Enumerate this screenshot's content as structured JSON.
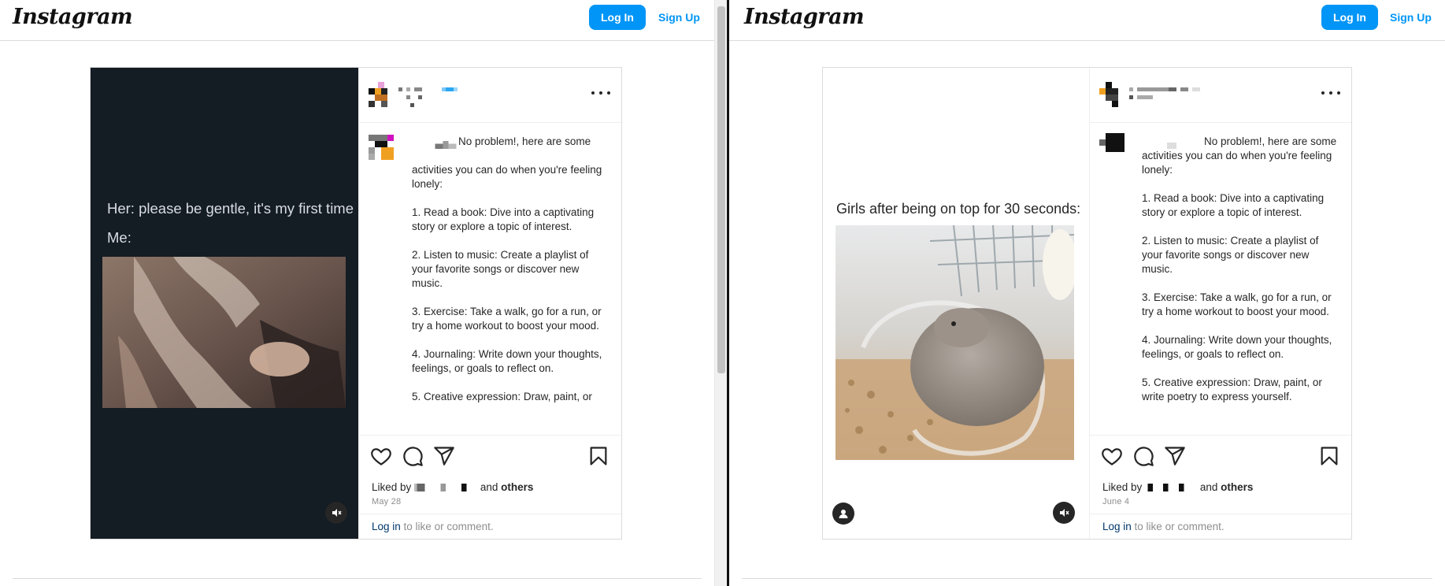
{
  "brand": {
    "logo_text": "Instagram",
    "accent_color": "#0095f6",
    "link_color": "#00376b"
  },
  "nav": {
    "login_label": "Log In",
    "signup_label": "Sign Up"
  },
  "posts": [
    {
      "meme_lines": [
        "Her: please be gentle, it's my first time",
        "Me:"
      ],
      "caption": "No problem!, here are some\n\nactivities you can do when you're feeling lonely:\n\n1. Read a book: Dive into a captivating story or explore a topic of interest.\n\n2. Listen to music: Create a playlist of your favorite songs or discover new music.\n\n3. Exercise: Take a walk, go for a run, or try a home workout to boost your mood.\n\n4. Journaling: Write down your thoughts, feelings, or goals to reflect on.\n\n5. Creative expression: Draw, paint, or",
      "liked_prefix": "Liked by",
      "liked_and": "and",
      "liked_others": "others",
      "date": "May 28",
      "login_link": "Log in",
      "login_suffix": " to like or comment.",
      "icons": [
        "heart-icon",
        "comment-icon",
        "share-icon",
        "bookmark-icon",
        "mute-icon",
        "more-icon"
      ]
    },
    {
      "meme_lines": [
        "Girls after being on top for 30 seconds:"
      ],
      "caption": "No problem!, here are some activities you can do when you're feeling lonely:\n\n1. Read a book: Dive into a captivating story or explore a topic of interest.\n\n2. Listen to music: Create a playlist of your favorite songs or discover new music.\n\n3. Exercise: Take a walk, go for a run, or try a home workout to boost your mood.\n\n4. Journaling: Write down your thoughts, feelings, or goals to reflect on.\n\n5. Creative expression: Draw, paint, or write poetry to express yourself.",
      "liked_prefix": "Liked by",
      "liked_and": "and",
      "liked_others": "others",
      "date": "June 4",
      "login_link": "Log in",
      "login_suffix": " to like or comment.",
      "icons": [
        "heart-icon",
        "comment-icon",
        "share-icon",
        "bookmark-icon",
        "mute-icon",
        "user-icon",
        "more-icon"
      ]
    }
  ]
}
